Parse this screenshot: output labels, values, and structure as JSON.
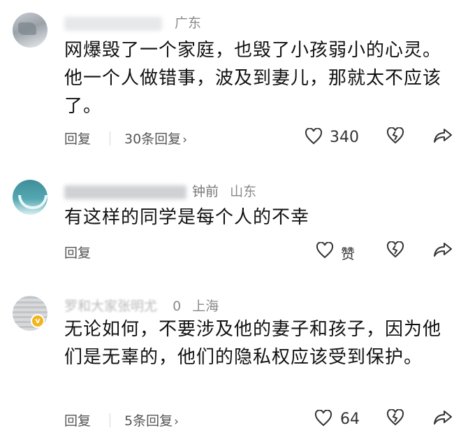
{
  "comments": [
    {
      "location": "广东",
      "text": "网爆毁了一个家庭，也毁了小孩弱小的心灵。他一个人做错事，波及到妻儿，那就太不应该了。",
      "reply_label": "回复",
      "replies_label": "30条回复",
      "like_count": "340"
    },
    {
      "time": "钟前",
      "location": "山东",
      "text": "有这样的同学是每个人的不幸",
      "reply_label": "回复",
      "like_count": "赞"
    },
    {
      "name": "罗和大家张明尤",
      "time": "0",
      "location": "上海",
      "badge": "v",
      "text": "无论如何，不要涉及他的妻子和孩子，因为他们是无辜的，他们的隐私权应该受到保护。",
      "reply_label": "回复",
      "replies_label": "5条回复",
      "like_count": "64"
    }
  ],
  "icons": {
    "like": "heart-outline-icon",
    "dislike": "broken-heart-icon",
    "share": "share-arrow-icon",
    "chevron": "chevron-right-icon"
  },
  "colors": {
    "text": "#111111",
    "meta": "#8a8a8a",
    "secondary": "#555555",
    "badge": "#f3b51c"
  }
}
